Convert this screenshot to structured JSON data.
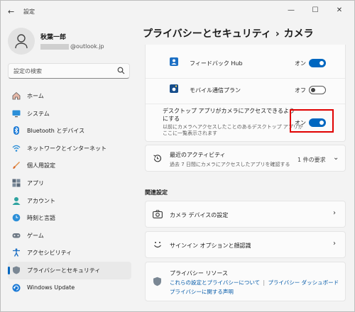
{
  "window": {
    "title": "設定"
  },
  "profile": {
    "name": "秋葉一郎",
    "email_suffix": "@outlook.jp"
  },
  "search": {
    "placeholder": "設定の検索"
  },
  "nav": [
    {
      "label": "ホーム",
      "icon": "home-icon"
    },
    {
      "label": "システム",
      "icon": "system-icon"
    },
    {
      "label": "Bluetooth とデバイス",
      "icon": "bluetooth-icon"
    },
    {
      "label": "ネットワークとインターネット",
      "icon": "network-icon"
    },
    {
      "label": "個人用設定",
      "icon": "brush-icon"
    },
    {
      "label": "アプリ",
      "icon": "apps-icon"
    },
    {
      "label": "アカウント",
      "icon": "account-icon"
    },
    {
      "label": "時刻と言語",
      "icon": "time-language-icon"
    },
    {
      "label": "ゲーム",
      "icon": "gaming-icon"
    },
    {
      "label": "アクセシビリティ",
      "icon": "accessibility-icon"
    },
    {
      "label": "プライバシーとセキュリティ",
      "icon": "shield-icon",
      "active": true
    },
    {
      "label": "Windows Update",
      "icon": "update-icon"
    }
  ],
  "breadcrumb": {
    "parent": "プライバシーとセキュリティ",
    "separator": "›",
    "current": "カメラ"
  },
  "apps": [
    {
      "name": "フィードバック Hub",
      "state": "オン",
      "on": true,
      "icon": "feedback-hub-icon"
    },
    {
      "name": "モバイル通信プラン",
      "state": "オフ",
      "on": false,
      "icon": "mobile-plans-icon"
    }
  ],
  "desktop_access": {
    "title": "デスクトップ アプリがカメラにアクセスできるようにする",
    "description": "以前にカメラへアクセスしたことのあるデスクトップ アプリがここに一覧表示されます",
    "state": "オン",
    "on": true
  },
  "recent_activity": {
    "title": "最近のアクティビティ",
    "description": "過去 7 日間にカメラにアクセスしたアプリを確認する",
    "count": "1 件の要求"
  },
  "related": {
    "heading": "関連設定",
    "items": [
      {
        "label": "カメラ デバイスの設定",
        "icon": "camera-icon"
      },
      {
        "label": "サインイン オプションと顔認識",
        "icon": "face-icon"
      }
    ]
  },
  "privacy_resources": {
    "title": "プライバシー リソース",
    "link1": "これらの設定とプライバシーについて",
    "divider": "|",
    "link2": "プライバシー ダッシュボード",
    "link3": "プライバシーに関する声明"
  },
  "colors": {
    "accent": "#0067c0",
    "highlight": "#e00000",
    "background": "#f3f3f3"
  }
}
